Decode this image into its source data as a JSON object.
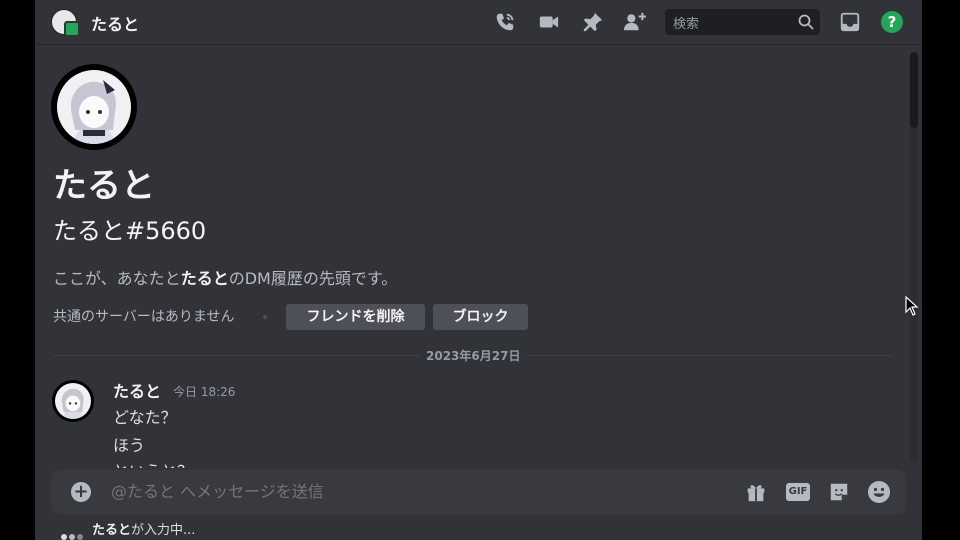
{
  "header": {
    "title": "たると",
    "search_placeholder": "検索",
    "help": "?"
  },
  "profile": {
    "display_name": "たると",
    "tag": "たると#5660",
    "intro_prefix": "ここが、あなたと",
    "intro_name": "たると",
    "intro_suffix": "のDM履歴の先頭です。",
    "mutual_servers": "共通のサーバーはありません",
    "remove_friend_label": "フレンドを削除",
    "block_label": "ブロック"
  },
  "divider": {
    "date": "2023年6月27日"
  },
  "message": {
    "author": "たると",
    "timestamp": "今日 18:26",
    "lines": [
      "どなた？",
      "ほう",
      "というと？"
    ]
  },
  "composer": {
    "plus": "+",
    "placeholder": "@たると へメッセージを送信",
    "gif_label": "GIF"
  },
  "typing": {
    "name": "たると",
    "suffix": "が入力中..."
  },
  "colors": {
    "background": "#313338",
    "online": "#23a55a",
    "button": "#4e5058"
  }
}
